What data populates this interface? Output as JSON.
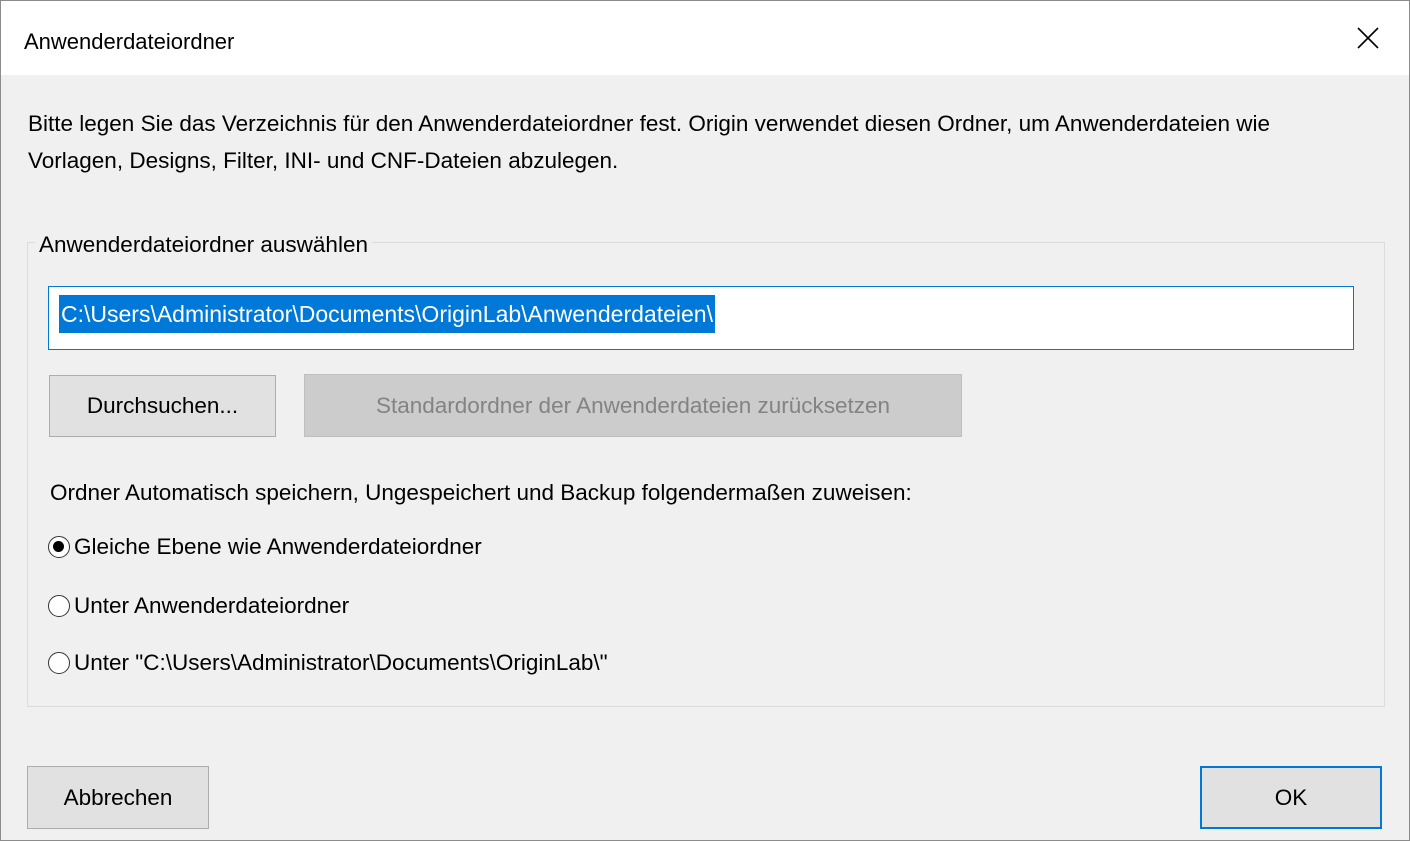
{
  "window": {
    "title": "Anwenderdateiordner"
  },
  "description": "Bitte legen Sie das Verzeichnis für den Anwenderdateiordner fest. Origin verwendet diesen Ordner, um Anwenderdateien wie Vorlagen, Designs, Filter, INI- und CNF-Dateien abzulegen.",
  "group": {
    "label": "Anwenderdateiordner auswählen",
    "path_value": "C:\\Users\\Administrator\\Documents\\OriginLab\\Anwenderdateien\\",
    "browse_label": "Durchsuchen...",
    "reset_label": "Standardordner der Anwenderdateien zurücksetzen",
    "assign_label": "Ordner Automatisch speichern, Ungespeichert und Backup folgendermaßen zuweisen:",
    "options": [
      {
        "label": "Gleiche Ebene wie Anwenderdateiordner",
        "checked": true
      },
      {
        "label": "Unter Anwenderdateiordner",
        "checked": false
      },
      {
        "label": "Unter \"C:\\Users\\Administrator\\Documents\\OriginLab\\\"",
        "checked": false
      }
    ]
  },
  "footer": {
    "cancel_label": "Abbrechen",
    "ok_label": "OK"
  },
  "colors": {
    "accent": "#0078d7",
    "dialog_bg": "#f0f0f0",
    "button_bg": "#e1e1e1",
    "disabled_button_bg": "#cccccc",
    "disabled_text": "#838383"
  },
  "icons": {
    "close": "close-icon"
  }
}
